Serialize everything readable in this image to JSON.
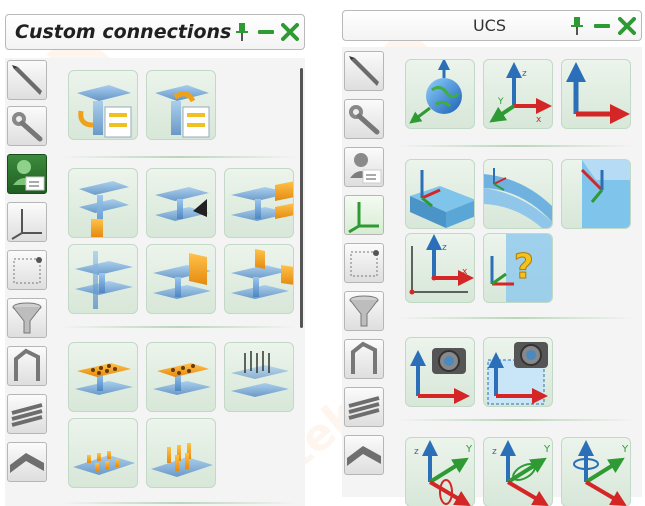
{
  "left_panel": {
    "title": "Custom connections",
    "pin_icon": "pin-icon",
    "minimize_icon": "minimize-icon",
    "close_icon": "close-icon",
    "sidebar": [
      "pencil-icon",
      "wrench-icon",
      "user-card-icon",
      "ucs-axes-icon",
      "point-box-icon",
      "funnel-icon",
      "bent-plate-icon",
      "profile-stack-icon",
      "angle-profile-icon"
    ],
    "tools": [
      {
        "icon": "connection-insert-icon"
      },
      {
        "icon": "connection-edit-icon"
      },
      {
        "icon": "beam-column-plate-icon"
      },
      {
        "icon": "beam-haunch-icon"
      },
      {
        "icon": "beam-splice-plate-icon"
      },
      {
        "icon": "beam-stiffener-icon"
      },
      {
        "icon": "beam-end-plate-icon"
      },
      {
        "icon": "beam-seat-icon"
      },
      {
        "icon": "bolted-plate-icon"
      },
      {
        "icon": "bolted-flange-icon"
      },
      {
        "icon": "anchor-rods-icon"
      },
      {
        "icon": "shear-studs-icon"
      },
      {
        "icon": "deck-studs-icon"
      }
    ]
  },
  "right_panel": {
    "title": "UCS",
    "pin_icon": "pin-icon",
    "minimize_icon": "minimize-icon",
    "close_icon": "close-icon",
    "sidebar": [
      "pencil-icon",
      "wrench-icon",
      "user-card-icon",
      "ucs-axes-icon",
      "point-box-icon",
      "funnel-icon",
      "bent-plate-icon",
      "profile-stack-icon",
      "angle-profile-icon"
    ],
    "tools": [
      {
        "icon": "ucs-world-icon"
      },
      {
        "icon": "ucs-3d-icon"
      },
      {
        "icon": "ucs-2d-icon"
      },
      {
        "icon": "ucs-object-icon"
      },
      {
        "icon": "ucs-curved-icon"
      },
      {
        "icon": "ucs-edge-icon"
      },
      {
        "icon": "ucs-3point-icon"
      },
      {
        "icon": "ucs-query-icon"
      },
      {
        "icon": "ucs-view-icon"
      },
      {
        "icon": "ucs-view-box-icon"
      },
      {
        "icon": "rotate-x-icon"
      },
      {
        "icon": "rotate-y-icon"
      },
      {
        "icon": "rotate-z-icon"
      }
    ],
    "axis_labels": {
      "x": "x",
      "y": "Y",
      "z": "z"
    }
  },
  "colors": {
    "accent_green": "#2e9a33",
    "axis_blue": "#2a6fb8",
    "axis_red": "#d42626",
    "plate_orange": "#f0a11a",
    "steel_blue": "#7fb2e0"
  }
}
